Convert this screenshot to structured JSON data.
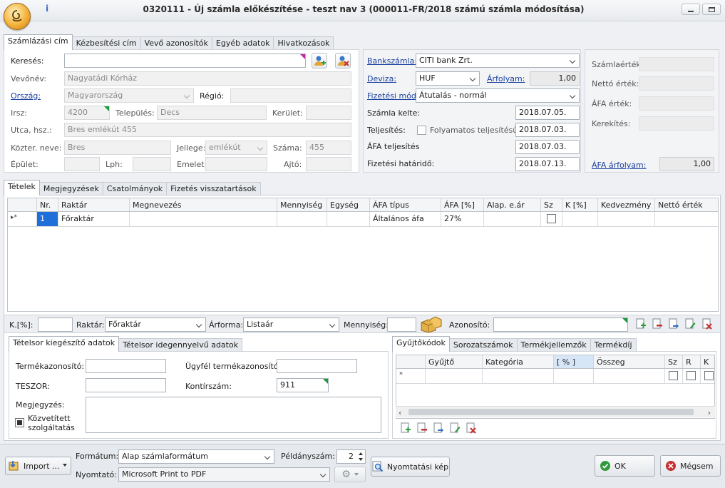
{
  "window": {
    "title": "0320111 - Új számla előkészítése - teszt nav 3 (000011-FR/2018 számú számla módosítása)",
    "info": "i"
  },
  "top_tabs": [
    "Számlázási cím",
    "Kézbesítési cím",
    "Vevő azonosítók",
    "Egyéb adatok",
    "Hivatkozások"
  ],
  "billing": {
    "search_label": "Keresés:",
    "search_value": "",
    "customer_label": "Vevőnév:",
    "customer_value": "Nagyatádi Kórház",
    "country_label": "Ország:",
    "country_value": "Magyarország",
    "region_label": "Régió:",
    "region_value": "",
    "zip_label": "Irsz:",
    "zip_value": "4200",
    "city_label": "Település:",
    "city_value": "Decs",
    "district_label": "Kerület:",
    "district_value": "",
    "street_label": "Utca, hsz.:",
    "street_value": "Bres emlékút 455",
    "public_label": "Közter. neve:",
    "public_value": "Bres",
    "type_label": "Jellege:",
    "type_value": "emlékút",
    "number_label": "Száma:",
    "number_value": "455",
    "building_label": "Épület:",
    "building_value": "",
    "staircase_label": "Lph:",
    "staircase_value": "",
    "floor_label": "Emelet:",
    "floor_value": "",
    "door_label": "Ajtó:",
    "door_value": ""
  },
  "payment": {
    "bank_label": "Bankszámla:",
    "bank_value": "CITI bank Zrt.",
    "currency_label": "Deviza:",
    "currency_value": "HUF",
    "rate_label": "Árfolyam:",
    "rate_value": "1,00",
    "method_label": "Fizetési mód:",
    "method_value": "Átutalás - normál",
    "date_label": "Számla kelte:",
    "date_value": "2018.07.05.",
    "fulfil_label": "Teljesítés:",
    "continuous_label": "Folyamatos teljesítésű",
    "fulfil_value": "2018.07.03.",
    "vat_fulfil_label": "ÁFA teljesítés",
    "vat_fulfil_value": "2018.07.03.",
    "deadline_label": "Fizetési határidő:",
    "deadline_value": "2018.07.13."
  },
  "totals": {
    "invoice_value_label": "Számlaérték:",
    "net_label": "Nettó érték:",
    "vat_label": "ÁFA érték:",
    "rounding_label": "Kerekítés:",
    "vat_rate_label": "ÁFA árfolyam:",
    "vat_rate_value": "1,00"
  },
  "item_tabs": [
    "Tételek",
    "Megjegyzések",
    "Csatolmányok",
    "Fizetés visszatartások"
  ],
  "items_table": {
    "columns": [
      "",
      "Nr.",
      "Raktár",
      "Megnevezés",
      "Mennyiség",
      "Egység",
      "ÁFA típus",
      "ÁFA [%]",
      "Alap. e.ár",
      "Sz",
      "K [%]",
      "Kedvezmény",
      "Nettó érték"
    ],
    "row": {
      "marker": "▸*",
      "nr": "1",
      "warehouse": "Főraktár",
      "name": "",
      "qty": "",
      "unit": "",
      "vat_type": "Általános áfa",
      "vat_pct": "27%",
      "base_price": "",
      "sz": "",
      "k": "",
      "discount": "",
      "net": ""
    }
  },
  "item_entry": {
    "k_label": "K.[%]:",
    "k_value": "",
    "warehouse_label": "Raktár:",
    "warehouse_value": "Főraktár",
    "price_label": "Árforma:",
    "price_value": "Listaár",
    "qty_label": "Mennyiség:",
    "qty_value": "",
    "id_label": "Azonosító:",
    "id_value": ""
  },
  "extra_tabs": [
    "Tételsor kiegészítő adatok",
    "Tételsor idegennyelvű adatok"
  ],
  "extra": {
    "product_id_label": "Termékazonosító:",
    "product_id_value": "",
    "customer_pid_label": "Ügyfél termékazonosító:",
    "customer_pid_value": "",
    "teszor_label": "TESZOR:",
    "teszor_value": "",
    "account_label": "Kontírszám:",
    "account_value": "911",
    "note_label": "Megjegyzés:",
    "note_value": "",
    "mediated_label": "Közvetített szolgáltatás"
  },
  "collector_tabs": [
    "Gyűjtőkódok",
    "Sorozatszámok",
    "Termékjellemzők",
    "Termékdíj"
  ],
  "collector_table": {
    "columns": [
      "",
      "Gyűjtő",
      "Kategória",
      "[ % ]",
      "Összeg",
      "Sz",
      "R",
      "K"
    ],
    "new_row_marker": "*"
  },
  "footer": {
    "import_label": "Import ...",
    "format_label": "Formátum:",
    "format_value": "Alap számlaformátum",
    "copies_label": "Példányszám:",
    "copies_value": "2",
    "printer_label": "Nyomtató:",
    "printer_value": "Microsoft Print to PDF",
    "preview_label": "Nyomtatási kép",
    "ok_label": "OK",
    "cancel_label": "Mégsem"
  },
  "colors": {
    "link": "#1a3f9c",
    "ok_icon": "#2e9b3c",
    "cancel_icon": "#c63030",
    "orb": "#e9a21c",
    "triangle_green": "#1a9a3a",
    "triangle_magenta": "#c02aa9"
  }
}
